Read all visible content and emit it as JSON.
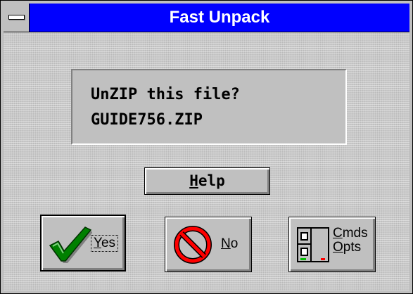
{
  "window": {
    "title": "Fast Unpack"
  },
  "message": {
    "line1": "UnZIP this file?",
    "line2": "GUIDE756.ZIP"
  },
  "buttons": {
    "help": {
      "accel": "H",
      "rest": "elp"
    },
    "yes": {
      "accel": "Y",
      "rest": "es"
    },
    "no": {
      "accel": "N",
      "rest": "o"
    },
    "cmds": {
      "accel1": "C",
      "rest1": "mds",
      "accel2": "O",
      "rest2": "pts"
    }
  },
  "icons": {
    "system_menu": "system-menu-icon",
    "yes": "checkmark-icon",
    "no": "no-entry-icon",
    "cmds": "commands-options-icon"
  },
  "colors": {
    "titlebar": "#0000ff",
    "face": "#c0c0c0",
    "checkmark": "#008000",
    "no_symbol": "#ff0000"
  }
}
